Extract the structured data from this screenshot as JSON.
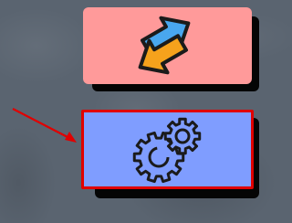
{
  "tiles": [
    {
      "name": "switch-app",
      "icon": "swap-arrows-icon",
      "color": "#ff9a9a"
    },
    {
      "name": "settings",
      "icon": "gears-icon",
      "color": "#7f9dff",
      "highlight": "#e00000"
    }
  ],
  "pointer": {
    "icon": "red-arrow-icon",
    "color": "#e00000"
  }
}
